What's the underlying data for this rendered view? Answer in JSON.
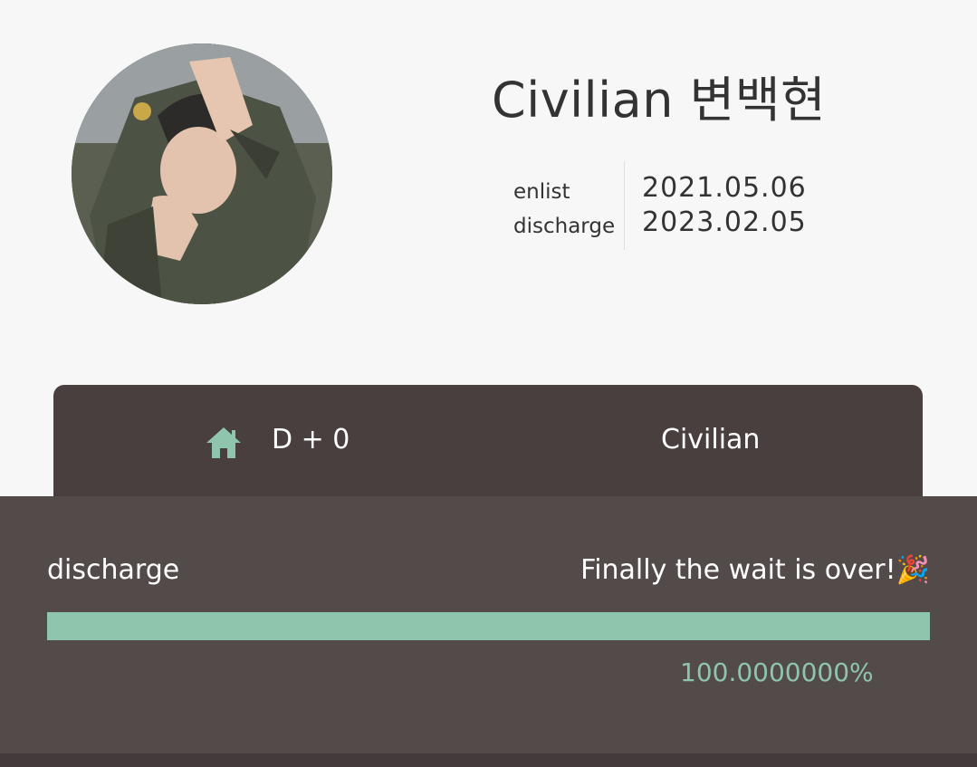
{
  "profile": {
    "name": "Civilian 변백현",
    "avatar_icon": "soldier-photo"
  },
  "service": {
    "enlist_label": "enlist",
    "discharge_label": "discharge",
    "enlist_date": "2021.05.06",
    "discharge_date": "2023.02.05"
  },
  "dday": {
    "icon": "home-icon",
    "text": "D + 0",
    "status": "Civilian"
  },
  "progress": {
    "label": "discharge",
    "message": "Finally the wait is over!🎉",
    "percent_text": "100.0000000%",
    "fraction": 1.0
  },
  "colors": {
    "accent": "#8ec5ac",
    "card": "#4a3f3f",
    "panel": "#534a4a"
  }
}
